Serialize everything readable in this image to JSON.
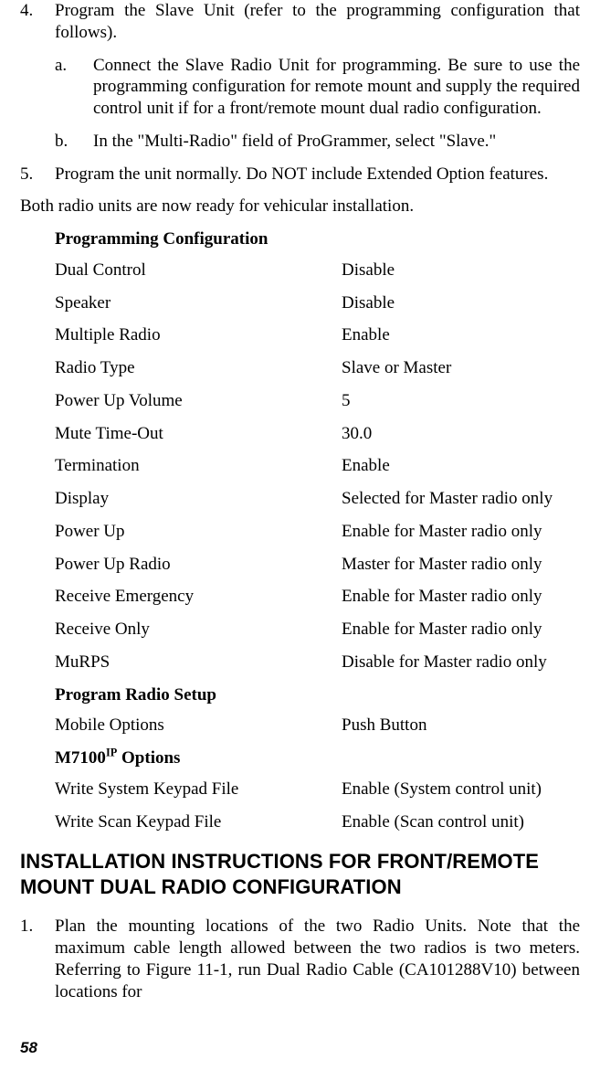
{
  "list4": {
    "marker": "4.",
    "text": "Program the Slave Unit (refer to the programming configuration that follows)."
  },
  "list4a": {
    "marker": "a.",
    "text": "Connect the Slave Radio Unit for programming.  Be sure to use the programming configuration for remote mount and supply the required control unit if for a front/remote mount dual radio configuration."
  },
  "list4b": {
    "marker": "b.",
    "text": "In the \"Multi-Radio\" field of ProGrammer, select \"Slave.\""
  },
  "list5": {
    "marker": "5.",
    "text": "Program the unit normally.  Do NOT include Extended Option features."
  },
  "ready_para": "Both radio units are now ready for vehicular installation.",
  "headings": {
    "prog_config": "Programming Configuration",
    "prog_radio_setup": "Program Radio Setup",
    "m7100_prefix": "M7100",
    "m7100_sup": "IP",
    "m7100_suffix": " Options"
  },
  "config": {
    "dual_control": {
      "k": "Dual Control",
      "v": "Disable"
    },
    "speaker": {
      "k": "Speaker",
      "v": "Disable"
    },
    "multiple_radio": {
      "k": "Multiple Radio",
      "v": "Enable"
    },
    "radio_type": {
      "k": "Radio Type",
      "v": "Slave or Master"
    },
    "power_up_vol": {
      "k": "Power Up Volume",
      "v": "5"
    },
    "mute_timeout": {
      "k": "Mute Time-Out",
      "v": "30.0"
    },
    "termination": {
      "k": "Termination",
      "v": "Enable"
    },
    "display": {
      "k": "Display",
      "v": "Selected for Master radio only"
    },
    "power_up": {
      "k": "Power Up",
      "v": "Enable for Master radio only"
    },
    "power_up_radio": {
      "k": "Power Up Radio",
      "v": "Master for Master radio only"
    },
    "recv_emerg": {
      "k": "Receive Emergency",
      "v": "Enable for Master radio only"
    },
    "recv_only": {
      "k": "Receive Only",
      "v": "Enable for Master radio only"
    },
    "murps": {
      "k": "MuRPS",
      "v": "Disable for Master radio only"
    },
    "mobile_opts": {
      "k": "Mobile Options",
      "v": "Push Button"
    },
    "write_sys": {
      "k": "Write System Keypad File",
      "v": "Enable (System control unit)"
    },
    "write_scan": {
      "k": "Write Scan Keypad File",
      "v": "Enable (Scan control unit)"
    }
  },
  "section_title": "INSTALLATION INSTRUCTIONS FOR FRONT/REMOTE MOUNT DUAL RADIO CONFIGURATION",
  "list_new1": {
    "marker": "1.",
    "text": "Plan the mounting locations of the two Radio Units.  Note that the maximum cable length allowed between the two radios is two meters.  Referring to Figure 11-1, run Dual Radio Cable (CA101288V10) between locations for"
  },
  "page_number": "58"
}
